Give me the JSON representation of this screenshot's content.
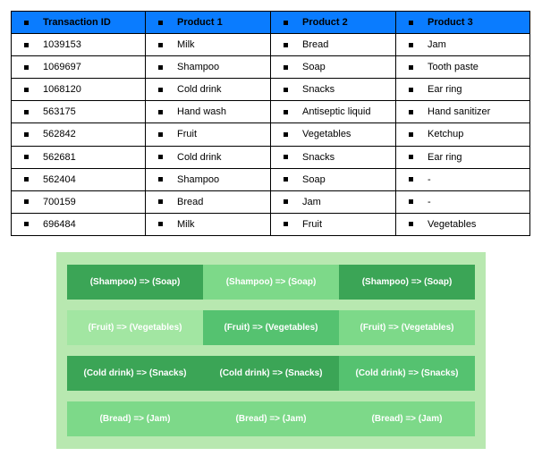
{
  "table": {
    "headers": [
      "Transaction ID",
      "Product 1",
      "Product 2",
      "Product 3"
    ],
    "rows": [
      {
        "id": "1039153",
        "p1": "Milk",
        "p2": "Bread",
        "p3": "Jam"
      },
      {
        "id": "1069697",
        "p1": "Shampoo",
        "p2": "Soap",
        "p3": "Tooth paste"
      },
      {
        "id": "1068120",
        "p1": "Cold drink",
        "p2": "Snacks",
        "p3": "Ear ring"
      },
      {
        "id": "563175",
        "p1": "Hand wash",
        "p2": "Antiseptic liquid",
        "p3": "Hand sanitizer"
      },
      {
        "id": "562842",
        "p1": "Fruit",
        "p2": "Vegetables",
        "p3": "Ketchup"
      },
      {
        "id": "562681",
        "p1": "Cold drink",
        "p2": "Snacks",
        "p3": "Ear ring"
      },
      {
        "id": "562404",
        "p1": "Shampoo",
        "p2": "Soap",
        "p3": "-"
      },
      {
        "id": "700159",
        "p1": "Bread",
        "p2": "Jam",
        "p3": "-"
      },
      {
        "id": "696484",
        "p1": "Milk",
        "p2": "Fruit",
        "p3": "Vegetables"
      }
    ]
  },
  "rules": {
    "rows": [
      {
        "tiles": [
          {
            "text": "(Shampoo) => (Soap)",
            "shade": "g-dark"
          },
          {
            "text": "(Shampoo) => (Soap)",
            "shade": "g-light"
          },
          {
            "text": "(Shampoo) => (Soap)",
            "shade": "g-dark"
          }
        ]
      },
      {
        "tiles": [
          {
            "text": "(Fruit) => (Vegetables)",
            "shade": "g-pale"
          },
          {
            "text": "(Fruit) => (Vegetables)",
            "shade": "g-mid"
          },
          {
            "text": "(Fruit) => (Vegetables)",
            "shade": "g-light"
          }
        ]
      },
      {
        "tiles": [
          {
            "text": "(Cold drink) => (Snacks)",
            "shade": "g-dark"
          },
          {
            "text": "(Cold drink) => (Snacks)",
            "shade": "g-dark"
          },
          {
            "text": "(Cold drink) => (Snacks)",
            "shade": "g-mid"
          }
        ]
      },
      {
        "tiles": [
          {
            "text": "(Bread) => (Jam)",
            "shade": "g-light"
          },
          {
            "text": "(Bread) => (Jam)",
            "shade": "g-light"
          },
          {
            "text": "(Bread) => (Jam)",
            "shade": "g-light"
          }
        ]
      }
    ]
  }
}
